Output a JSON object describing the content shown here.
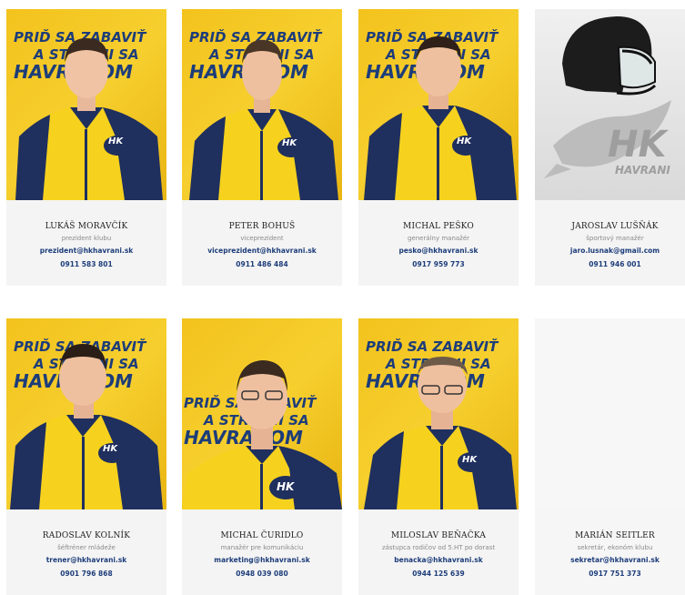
{
  "slogan": {
    "line1": "PRIĎ SA ZABAVIŤ",
    "line2": "A STRETNI SA",
    "line3": "HAVRANOM"
  },
  "logo_text": "HK",
  "logo_sub": "HAVRANI",
  "people": [
    {
      "name": "LUKÁŠ MORAVČÍK",
      "role": "prezident klubu",
      "email": "prezident@hkhavrani.sk",
      "phone": "0911 583 801"
    },
    {
      "name": "PETER BOHUŠ",
      "role": "viceprezident",
      "email": "viceprezident@hkhavrani.sk",
      "phone": "0911 486 484"
    },
    {
      "name": "MICHAL PEŠKO",
      "role": "generálny manažér",
      "email": "pesko@hkhavrani.sk",
      "phone": "0917 959 773"
    },
    {
      "name": "JAROSLAV LUŠŇÁK",
      "role": "športový manažér",
      "email": "jaro.lusnak@gmail.com",
      "phone": "0911 946 001"
    },
    {
      "name": "RADOSLAV KOLNÍK",
      "role": "šéftréner mládeže",
      "email": "trener@hkhavrani.sk",
      "phone": "0901 796 868"
    },
    {
      "name": "MICHAL ČURIDLO",
      "role": "manažér pre komunikáciu",
      "email": "marketing@hkhavrani.sk",
      "phone": "0948 039 080"
    },
    {
      "name": "MILOSLAV BEŇAČKA",
      "role": "zástupca rodičov od 5.HT po dorast",
      "email": "benacka@hkhavrani.sk",
      "phone": "0944 125 639"
    },
    {
      "name": "MARIÁN SEITLER",
      "role": "sekretár, ekonóm klubu",
      "email": "sekretar@hkhavrani.sk",
      "phone": "0917 751 373"
    }
  ],
  "colors": {
    "yellow": "#f3c21d",
    "navy": "#1d3d7a",
    "name": "#222222",
    "role": "#8a8a8a"
  }
}
